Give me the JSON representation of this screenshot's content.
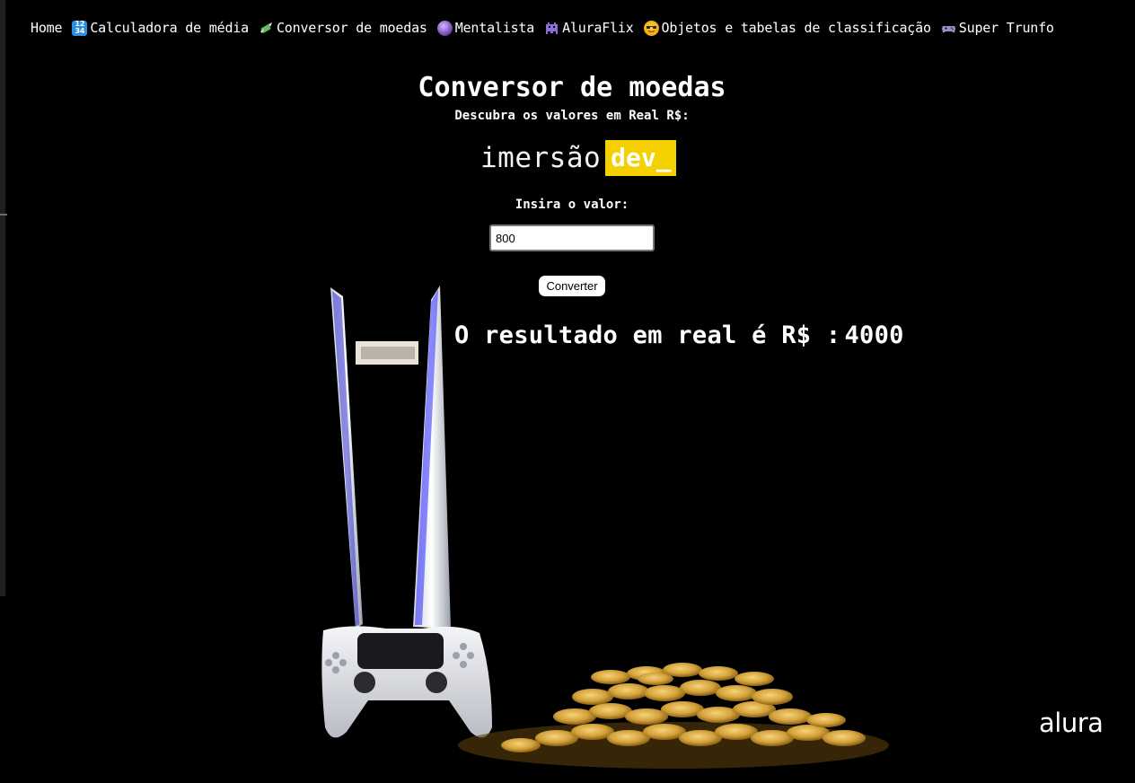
{
  "nav": {
    "items": [
      {
        "label": "Home",
        "icon": null
      },
      {
        "label": "Calculadora de média",
        "icon": "numbers-icon"
      },
      {
        "label": "Conversor de moedas",
        "icon": "money-with-wings-icon"
      },
      {
        "label": "Mentalista",
        "icon": "crystal-ball-icon"
      },
      {
        "label": "AluraFlix",
        "icon": "alien-monster-icon"
      },
      {
        "label": "Objetos e tabelas de classificação",
        "icon": "sunglasses-face-icon"
      },
      {
        "label": "Super Trunfo",
        "icon": "game-controller-icon"
      }
    ]
  },
  "header": {
    "title": "Conversor de moedas",
    "subtitle": "Descubra os valores em Real R$:"
  },
  "logo": {
    "word": "imersão",
    "badge": "dev_"
  },
  "form": {
    "label": "Insira o valor:",
    "input_value": "800",
    "button_label": "Converter"
  },
  "result": {
    "prefix": "O resultado em real é R$ :",
    "value": "4000"
  },
  "footer": {
    "brand": "alura"
  },
  "colors": {
    "background": "#000000",
    "text": "#ffffff",
    "logo_badge": "#f5d000",
    "console_accent": "#3b3bff",
    "coins": "#d9a830"
  }
}
